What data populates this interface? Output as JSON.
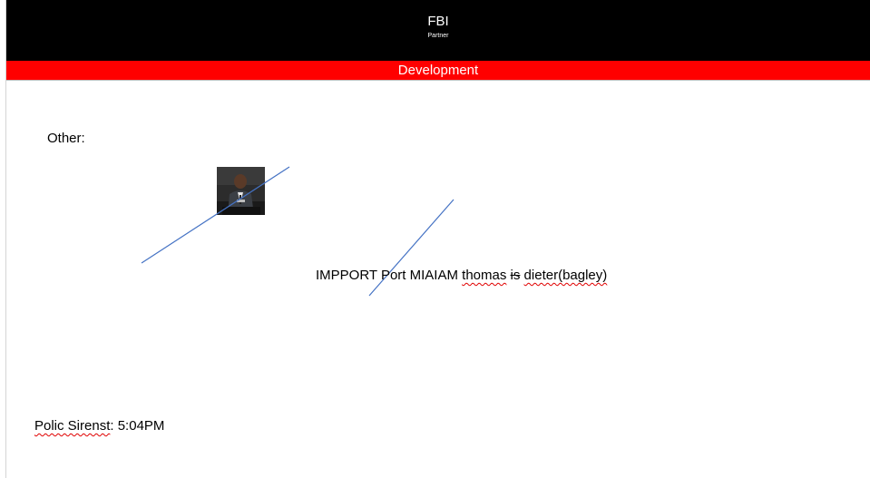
{
  "header": {
    "title": "FBI",
    "subtitle": "Partner"
  },
  "banner": {
    "label": "Development"
  },
  "body": {
    "other_label": "Other:",
    "import_text": {
      "plain": "IMPPORT Port MIAIAM",
      "struck_1": "thomas",
      "struck_2": "is",
      "struck_3": "dieter(bagley)"
    },
    "police": {
      "label": "Polic Sirenst",
      "separator": ":",
      "time": "5:04PM"
    }
  },
  "colors": {
    "header_bg": "#000000",
    "banner_bg": "#ff0000",
    "line": "#4472c4",
    "spellcheck": "#e00000"
  }
}
